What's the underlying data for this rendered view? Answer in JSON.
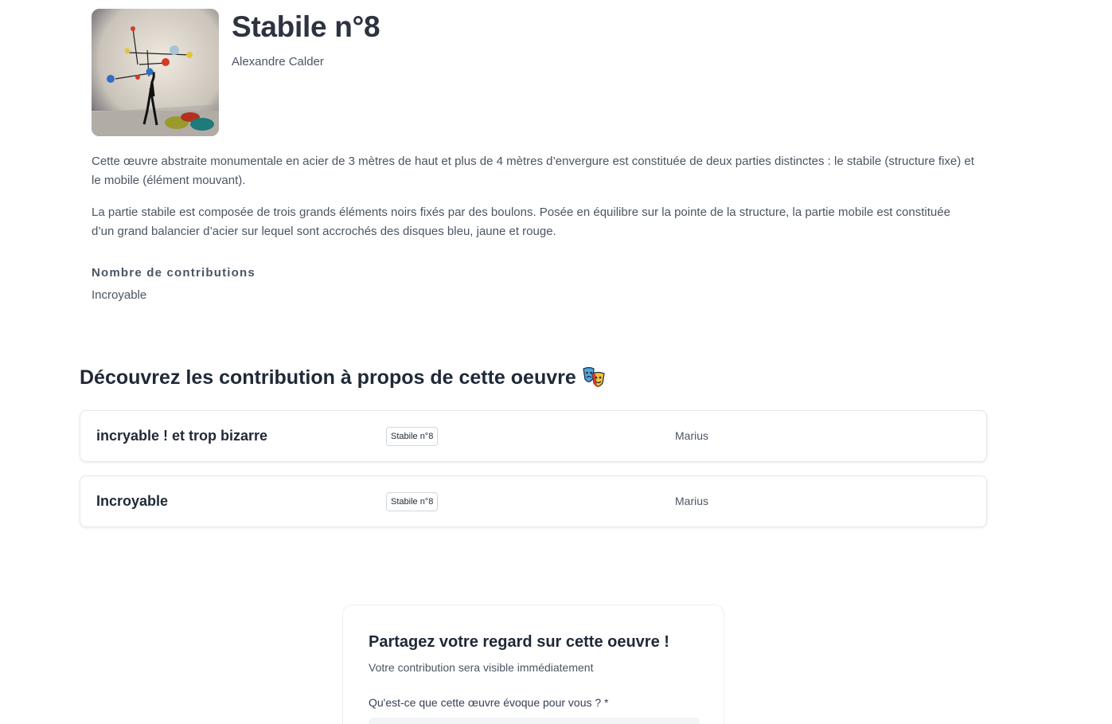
{
  "artwork": {
    "title": "Stabile n°8",
    "artist": "Alexandre Calder",
    "image_alt": "Stabile n°8",
    "description": [
      "Cette œuvre abstraite monumentale en acier de 3 mètres de haut et plus de 4 mètres d’envergure est constituée de deux parties distinctes : le stabile (structure fixe) et le mobile (élément mouvant).",
      "La partie stabile est composée de trois grands éléments noirs fixés par des boulons. Posée en équilibre sur la pointe de la structure, la partie mobile est constituée d’un grand balancier d’acier sur lequel sont accrochés des disques bleu, jaune et rouge."
    ],
    "contributions_label": "Nombre de contributions",
    "contributions_value": "Incroyable"
  },
  "contributions_section": {
    "title": "Découvrez les contribution à propos de cette oeuvre",
    "icon": "theater-masks-icon",
    "items": [
      {
        "title": "incryable ! et trop bizarre",
        "badge": "Stabile n°8",
        "author": "Marius"
      },
      {
        "title": "Incroyable",
        "badge": "Stabile n°8",
        "author": "Marius"
      }
    ]
  },
  "form": {
    "title": "Partagez votre regard sur cette oeuvre !",
    "subtitle": "Votre contribution sera visible immédiatement",
    "question_label": "Qu'est-ce que cette œuvre évoque pour vous ? *",
    "question_value": ""
  }
}
